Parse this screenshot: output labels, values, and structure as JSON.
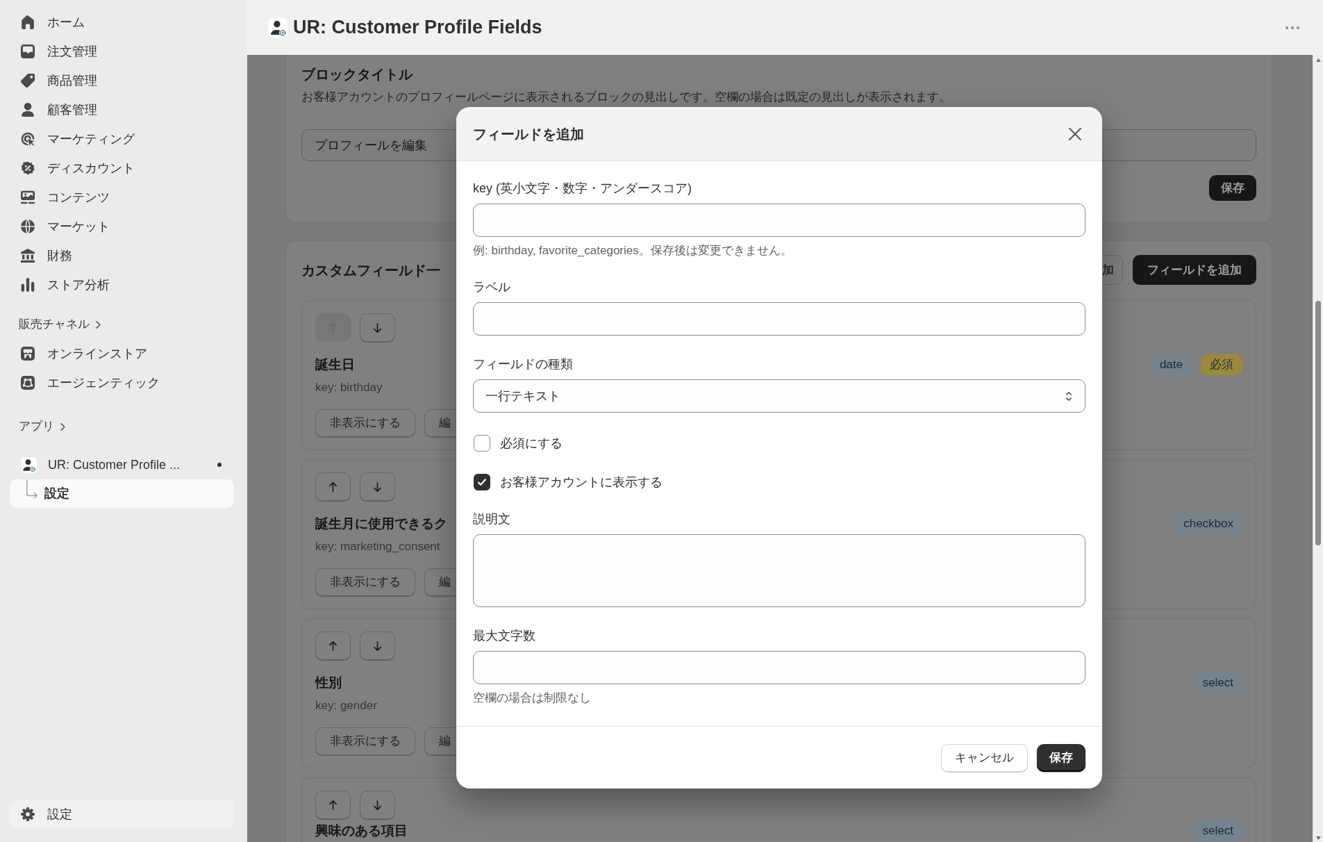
{
  "sidebar": {
    "nav_items": [
      {
        "label": "ホーム",
        "selected": false
      },
      {
        "label": "注文管理",
        "selected": false
      },
      {
        "label": "商品管理",
        "selected": false
      },
      {
        "label": "顧客管理",
        "selected": false
      },
      {
        "label": "マーケティング",
        "selected": false
      },
      {
        "label": "ディスカウント",
        "selected": false
      },
      {
        "label": "コンテンツ",
        "selected": false
      },
      {
        "label": "マーケット",
        "selected": false
      },
      {
        "label": "財務",
        "selected": false
      },
      {
        "label": "ストア分析",
        "selected": false
      }
    ],
    "sales_channels": {
      "heading": "販売チャネル",
      "items": [
        {
          "label": "オンラインストア",
          "selected": false
        },
        {
          "label": "エージェンティック",
          "selected": false
        }
      ]
    },
    "apps": {
      "heading": "アプリ",
      "items": [
        {
          "label": "UR: Customer Profile ...",
          "selected": false,
          "children": [
            {
              "label": "設定",
              "selected": true
            }
          ]
        }
      ]
    },
    "settings": {
      "label": "設定",
      "selected": false
    }
  },
  "app_bar": {
    "title": "UR: Customer Profile Fields"
  },
  "block_title_card": {
    "title": "ブロックタイトル",
    "description": "お客様アカウントのプロフィールページに表示されるブロックの見出しです。空欄の場合は既定の見出しが表示されます。",
    "field": {
      "value": "プロフィールを編集"
    },
    "button": {
      "label": "保存",
      "kind": "primary"
    }
  },
  "custom_fields_card": {
    "title": "カスタムフィールド一",
    "buttons": [
      {
        "label": "加",
        "kind": "secondary"
      },
      {
        "label": "フィールドを追加",
        "kind": "primary"
      }
    ],
    "fields": [
      {
        "name": "誕生日",
        "key": "key: birthday",
        "move_up_disabled": true,
        "actions": [
          "非表示にする",
          "編"
        ],
        "badges": [
          {
            "label": "date",
            "color": "#75838f"
          },
          {
            "label": "必須",
            "color": "#9c8a3a"
          }
        ]
      },
      {
        "name": "誕生月に使用できるク",
        "key": "key: marketing_consent",
        "move_up_disabled": false,
        "actions": [
          "非表示にする",
          "編"
        ],
        "badges": [
          {
            "label": "checkbox",
            "color": "#75838f"
          }
        ]
      },
      {
        "name": "性別",
        "key": "key: gender",
        "move_up_disabled": false,
        "actions": [
          "非表示にする",
          "編"
        ],
        "badges": [
          {
            "label": "select",
            "color": "#75838f"
          }
        ]
      },
      {
        "name": "興味のある項目",
        "move_up_disabled": false,
        "badges": [
          {
            "label": "select",
            "color": "#75838f"
          }
        ]
      }
    ]
  },
  "modal": {
    "title": "フィールドを追加",
    "fields": [
      {
        "kind": "text",
        "label": "key (英小文字・数字・アンダースコア)",
        "help": "例: birthday, favorite_categories。保存後は変更できません。"
      },
      {
        "kind": "text",
        "label": "ラベル"
      },
      {
        "kind": "select",
        "label": "フィールドの種類",
        "value": "一行テキスト"
      },
      {
        "kind": "checkbox",
        "label": "必須にする",
        "checked": false
      },
      {
        "kind": "checkbox",
        "label": "お客様アカウントに表示する",
        "checked": true
      },
      {
        "kind": "textarea",
        "label": "説明文"
      },
      {
        "kind": "text",
        "label": "最大文字数",
        "help": "空欄の場合は制限なし"
      }
    ],
    "buttons": [
      {
        "label": "キャンセル",
        "kind": "secondary"
      },
      {
        "label": "保存",
        "kind": "primary"
      }
    ]
  }
}
